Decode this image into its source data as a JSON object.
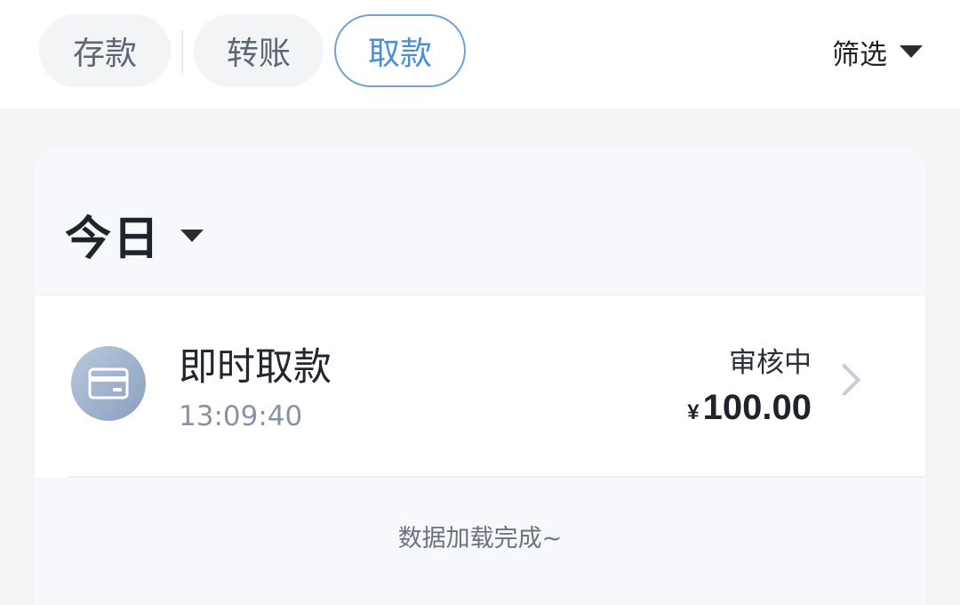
{
  "tabs": [
    {
      "label": "存款",
      "active": false
    },
    {
      "label": "转账",
      "active": false
    },
    {
      "label": "取款",
      "active": true
    }
  ],
  "filter": {
    "label": "筛选",
    "icon": "caret-down-icon"
  },
  "day_group": {
    "title": "今日",
    "icon": "caret-down-icon"
  },
  "records": [
    {
      "title": "即时取款",
      "time": "13:09:40",
      "status": "审核中",
      "currency": "¥",
      "amount": "100.00",
      "icon": "card-icon"
    }
  ],
  "footer": {
    "message": "数据加载完成~"
  },
  "colors": {
    "accent": "#4a90d9",
    "accent_border": "#6fa3d8"
  }
}
